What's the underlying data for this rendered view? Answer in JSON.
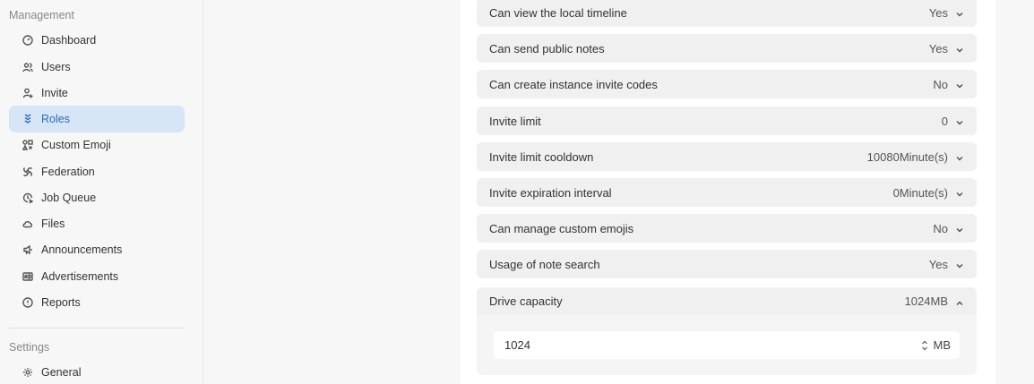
{
  "sidebar": {
    "management_title": "Management",
    "settings_title": "Settings",
    "items": [
      {
        "label": "Dashboard",
        "icon": "dashboard-icon"
      },
      {
        "label": "Users",
        "icon": "users-icon"
      },
      {
        "label": "Invite",
        "icon": "user-plus-icon"
      },
      {
        "label": "Roles",
        "icon": "badges-icon"
      },
      {
        "label": "Custom Emoji",
        "icon": "icons-icon"
      },
      {
        "label": "Federation",
        "icon": "whirl-icon"
      },
      {
        "label": "Job Queue",
        "icon": "clock-play-icon"
      },
      {
        "label": "Files",
        "icon": "cloud-icon"
      },
      {
        "label": "Announcements",
        "icon": "speakerphone-icon"
      },
      {
        "label": "Advertisements",
        "icon": "ad-icon"
      },
      {
        "label": "Reports",
        "icon": "exclamation-circle-icon"
      }
    ],
    "settings_items": [
      {
        "label": "General",
        "icon": "gear-icon"
      }
    ],
    "active_item": "Roles",
    "active_color": "#2a6bbf"
  },
  "policies": [
    {
      "label": "Can view the local timeline",
      "value": "Yes"
    },
    {
      "label": "Can send public notes",
      "value": "Yes"
    },
    {
      "label": "Can create instance invite codes",
      "value": "No"
    },
    {
      "label": "Invite limit",
      "value": "0"
    },
    {
      "label": "Invite limit cooldown",
      "value": "10080Minute(s)"
    },
    {
      "label": "Invite expiration interval",
      "value": "0Minute(s)"
    },
    {
      "label": "Can manage custom emojis",
      "value": "No"
    },
    {
      "label": "Usage of note search",
      "value": "Yes"
    }
  ],
  "drive": {
    "label": "Drive capacity",
    "value": "1024MB",
    "input_value": "1024",
    "unit": "MB"
  }
}
